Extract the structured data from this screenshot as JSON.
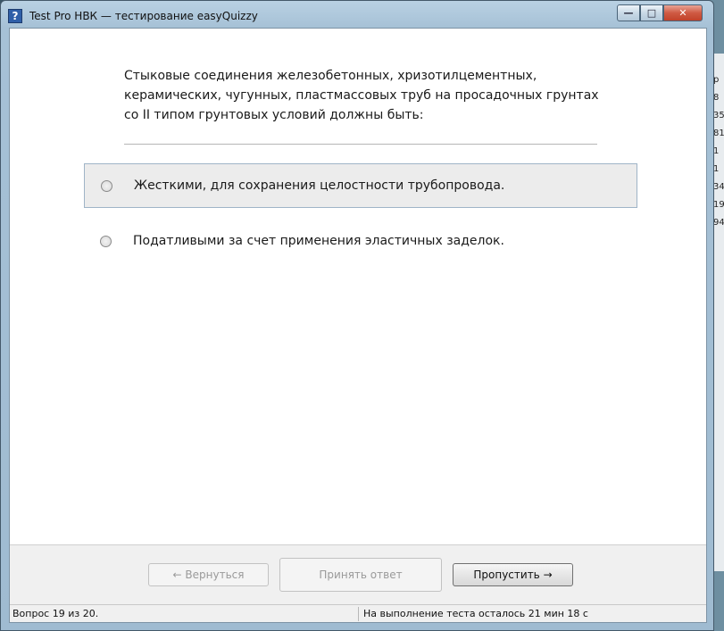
{
  "window": {
    "title": "Test Pro НВК — тестирование easyQuizzy",
    "app_icon_glyph": "?",
    "minimize_glyph": "—",
    "maximize_glyph": "□",
    "close_glyph": "✕"
  },
  "question": {
    "text": "Стыковые соединения железобетонных, хризотилцементных, керамических, чугунных, пластмассовых труб на просадочных грунтах со II типом грунтовых условий должны быть:"
  },
  "answers": [
    {
      "label": "Жесткими, для сохранения целостности трубопровода.",
      "selected": false,
      "highlighted": true
    },
    {
      "label": "Податливыми за счет применения эластичных заделок.",
      "selected": false,
      "highlighted": false
    }
  ],
  "buttons": {
    "back": "← Вернуться",
    "accept": "Принять ответ",
    "skip": "Пропустить →"
  },
  "status": {
    "progress": "Вопрос 19 из 20.",
    "time_left": "На выполнение теста осталось 21 мин 18 с"
  },
  "background_fragments": [
    "р",
    "8",
    "35",
    "81",
    "1",
    "1",
    "34",
    "19",
    "94"
  ]
}
